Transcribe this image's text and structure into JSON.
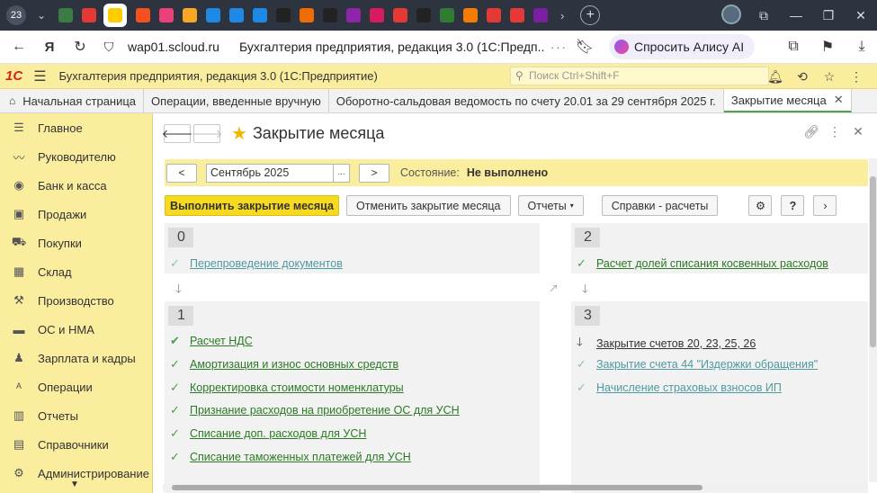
{
  "browser": {
    "tab_count": "23",
    "url": "wap01.scloud.ru",
    "page_title": "Бухгалтерия предприятия, редакция 3.0 (1С:Предп...",
    "alice_label": "Спросить Алису AI",
    "favicons": [
      {
        "name": "fav-1",
        "color": "#3a7d44"
      },
      {
        "name": "fav-2",
        "color": "#e53935"
      },
      {
        "name": "fav-4",
        "color": "#f4511e"
      },
      {
        "name": "fav-5",
        "color": "#ec407a"
      },
      {
        "name": "fav-6",
        "color": "#f9a825"
      },
      {
        "name": "fav-7",
        "color": "#1e88e5"
      },
      {
        "name": "fav-8",
        "color": "#1e88e5"
      },
      {
        "name": "fav-9",
        "color": "#1e88e5"
      },
      {
        "name": "fav-10",
        "color": "#222222"
      },
      {
        "name": "fav-11",
        "color": "#ef6c00"
      },
      {
        "name": "fav-12",
        "color": "#222222"
      },
      {
        "name": "fav-13",
        "color": "#8e24aa"
      },
      {
        "name": "fav-14",
        "color": "#d81b60"
      },
      {
        "name": "fav-15",
        "color": "#e53935"
      },
      {
        "name": "fav-16",
        "color": "#222222"
      },
      {
        "name": "fav-17",
        "color": "#2e7d32"
      },
      {
        "name": "fav-18",
        "color": "#f57c00"
      },
      {
        "name": "fav-19",
        "color": "#e53935"
      },
      {
        "name": "fav-20",
        "color": "#e53935"
      },
      {
        "name": "fav-21",
        "color": "#7b1fa2"
      }
    ]
  },
  "app": {
    "logo": "1С",
    "title": "Бухгалтерия предприятия, редакция 3.0  (1С:Предприятие)",
    "search_placeholder": "Поиск Ctrl+Shift+F"
  },
  "tabs": [
    {
      "label": "Начальная страница",
      "icon": "home-icon"
    },
    {
      "label": "Операции, введенные вручную"
    },
    {
      "label": "Оборотно-сальдовая ведомость по счету 20.01 за 29 сентября 2025 г."
    },
    {
      "label": "Закрытие месяца",
      "close": "✕",
      "active": true
    }
  ],
  "sidebar": {
    "items": [
      {
        "label": "Главное",
        "icon": "☰"
      },
      {
        "label": "Руководителю",
        "icon": "〰"
      },
      {
        "label": "Банк и касса",
        "icon": "◉"
      },
      {
        "label": "Продажи",
        "icon": "▣"
      },
      {
        "label": "Покупки",
        "icon": "⛟"
      },
      {
        "label": "Склад",
        "icon": "▦"
      },
      {
        "label": "Производство",
        "icon": "⚒"
      },
      {
        "label": "ОС и НМА",
        "icon": "▬"
      },
      {
        "label": "Зарплата и кадры",
        "icon": "♟"
      },
      {
        "label": "Операции",
        "icon": "ᴬ"
      },
      {
        "label": "Отчеты",
        "icon": "▥"
      },
      {
        "label": "Справочники",
        "icon": "▤"
      },
      {
        "label": "Администрирование",
        "icon": "⚙"
      }
    ]
  },
  "form": {
    "title": "Закрытие месяца",
    "prev": "<",
    "period": "Сентябрь 2025",
    "period_dots": "...",
    "next": ">",
    "status_label": "Состояние:",
    "status_value": "Не выполнено",
    "buttons": {
      "run": "Выполнить закрытие месяца",
      "cancel": "Отменить закрытие месяца",
      "reports": "Отчеты",
      "refs": "Справки - расчеты",
      "help": "?",
      "more": "›"
    }
  },
  "stages": {
    "s0": {
      "num": "0",
      "ops": [
        {
          "label": "Перепроведение документов",
          "state": "done-faded"
        }
      ]
    },
    "s1": {
      "num": "1",
      "ops": [
        {
          "label": "Расчет НДС",
          "state": "done"
        },
        {
          "label": "Амортизация и износ основных средств",
          "state": "done"
        },
        {
          "label": "Корректировка стоимости номенклатуры",
          "state": "done"
        },
        {
          "label": "Признание расходов на приобретение ОС для УСН",
          "state": "done"
        },
        {
          "label": "Списание доп. расходов для УСН",
          "state": "done"
        },
        {
          "label": "Списание таможенных платежей для УСН",
          "state": "done"
        }
      ]
    },
    "s2": {
      "num": "2",
      "ops": [
        {
          "label": "Расчет долей списания косвенных расходов",
          "state": "done"
        }
      ]
    },
    "s3": {
      "num": "3",
      "ops": [
        {
          "label": "Закрытие счетов 20, 23, 25, 26",
          "state": "pending"
        },
        {
          "label": "Закрытие счета 44 \"Издержки обращения\"",
          "state": "done-faded"
        },
        {
          "label": "Начисление страховых взносов ИП",
          "state": "done-faded"
        }
      ]
    }
  },
  "colors": {
    "accent_yellow": "#fbed9e",
    "primary_button": "#f7da20",
    "link_green": "#2b7a23",
    "link_teal": "#4f9aa0",
    "logo_red": "#d8231b"
  }
}
